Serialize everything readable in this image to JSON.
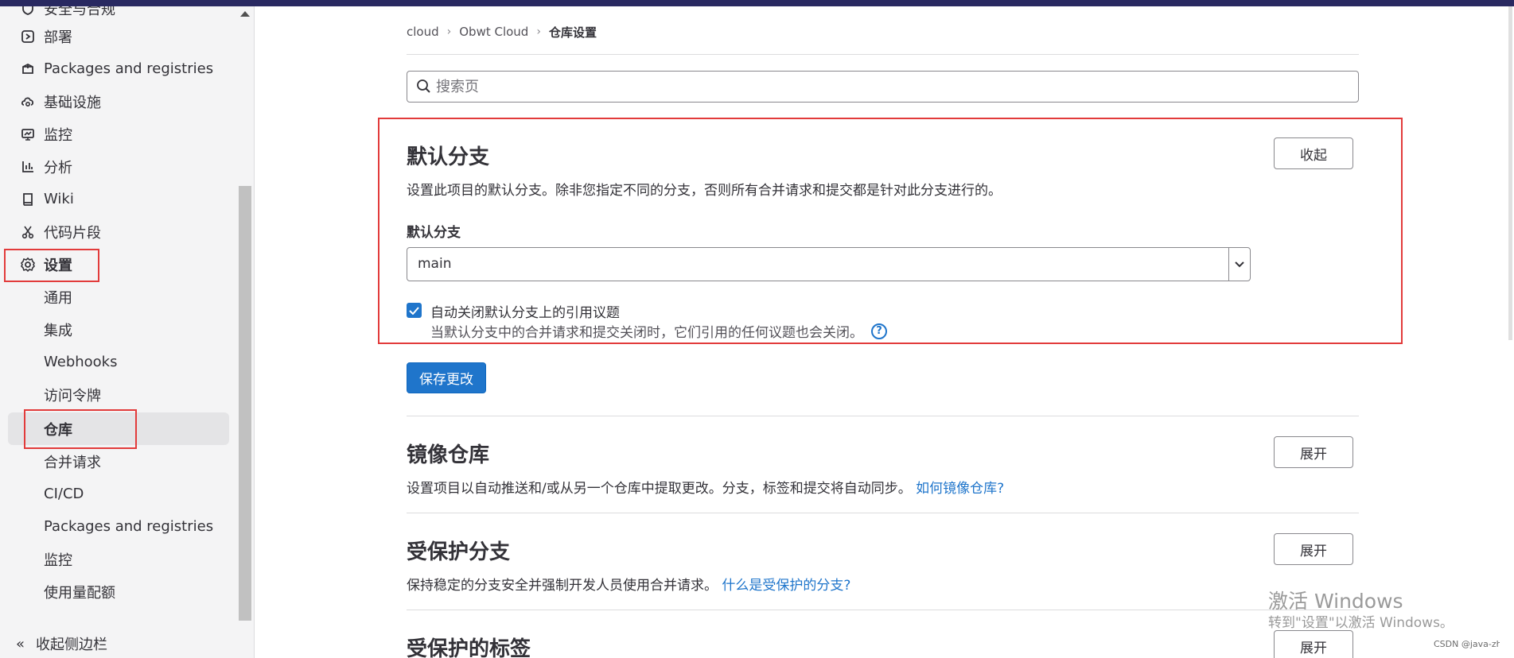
{
  "sidebar": {
    "top_cut_item": "安全与合规",
    "items": [
      {
        "label": "部署",
        "icon": "deploy-icon"
      },
      {
        "label": "Packages and registries",
        "icon": "package-icon"
      },
      {
        "label": "基础设施",
        "icon": "cloud-gear-icon"
      },
      {
        "label": "监控",
        "icon": "monitor-icon"
      },
      {
        "label": "分析",
        "icon": "chart-icon"
      },
      {
        "label": "Wiki",
        "icon": "book-icon"
      },
      {
        "label": "代码片段",
        "icon": "scissors-icon"
      },
      {
        "label": "设置",
        "icon": "gear-icon"
      }
    ],
    "sub_items": [
      {
        "label": "通用"
      },
      {
        "label": "集成"
      },
      {
        "label": "Webhooks"
      },
      {
        "label": "访问令牌"
      },
      {
        "label": "仓库"
      },
      {
        "label": "合并请求"
      },
      {
        "label": "CI/CD"
      },
      {
        "label": "Packages and registries"
      },
      {
        "label": "监控"
      },
      {
        "label": "使用量配额"
      }
    ],
    "collapse_label": "收起侧边栏"
  },
  "breadcrumb": {
    "items": [
      "cloud",
      "Obwt Cloud",
      "仓库设置"
    ]
  },
  "search": {
    "placeholder": "搜索页"
  },
  "sections": {
    "default_branch": {
      "title": "默认分支",
      "description": "设置此项目的默认分支。除非您指定不同的分支，否则所有合并请求和提交都是针对此分支进行的。",
      "toggle_label": "收起",
      "field_label": "默认分支",
      "selected_branch": "main",
      "checkbox_label": "自动关闭默认分支上的引用议题",
      "checkbox_checked": true,
      "checkbox_help": "当默认分支中的合并请求和提交关闭时，它们引用的任何议题也会关闭。",
      "save_label": "保存更改"
    },
    "mirror": {
      "title": "镜像仓库",
      "description": "设置项目以自动推送和/或从另一个仓库中提取更改。分支，标签和提交将自动同步。",
      "link": "如何镜像仓库?",
      "toggle_label": "展开"
    },
    "protected_branches": {
      "title": "受保护分支",
      "description": "保持稳定的分支安全并强制开发人员使用合并请求。",
      "link": "什么是受保护的分支?",
      "toggle_label": "展开"
    },
    "protected_tags": {
      "title": "受保护的标签",
      "toggle_label": "展开"
    }
  },
  "overlay": {
    "activate_title": "激活 Windows",
    "activate_sub": "转到\"设置\"以激活 Windows。",
    "credit": "CSDN @java-zh"
  },
  "colors": {
    "primary": "#1f75cb",
    "highlight": "#e23b3b",
    "topbar": "#292961"
  }
}
